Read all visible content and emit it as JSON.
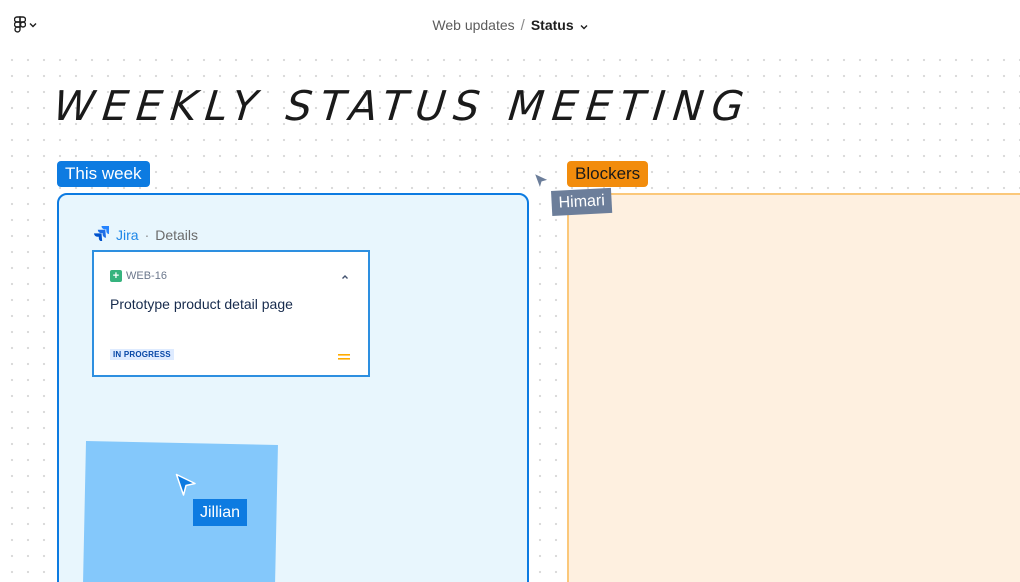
{
  "topbar": {
    "menu_icon": "figma-logo-icon",
    "breadcrumb_parent": "Web updates",
    "breadcrumb_separator": "/",
    "breadcrumb_current": "Status"
  },
  "board": {
    "title": "WEEKLY STATUS MEETING",
    "sections": {
      "this_week": {
        "label": "This week",
        "color": "#0d7be1",
        "fill": "#e8f6fd"
      },
      "blockers": {
        "label": "Blockers",
        "color": "#f28c0c",
        "fill": "#fef0e0"
      }
    }
  },
  "jira_widget": {
    "app_name": "Jira",
    "separator": "·",
    "view_label": "Details",
    "issue": {
      "key": "WEB-16",
      "type_icon": "story-plus-icon",
      "summary": "Prototype product detail page",
      "status": "IN PROGRESS",
      "priority_icon": "priority-medium-icon"
    }
  },
  "sticky_note": {
    "color": "#84c8fb"
  },
  "collaborators": [
    {
      "name": "Himari",
      "color": "#6c7e9a"
    },
    {
      "name": "Jillian",
      "color": "#0d7be1"
    }
  ]
}
